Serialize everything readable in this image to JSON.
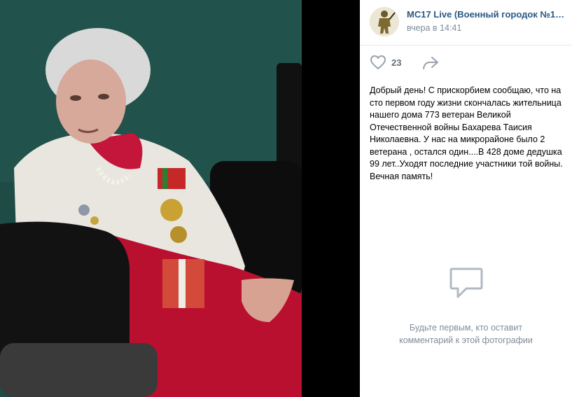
{
  "post": {
    "author": "MC17 Live (Военный городок №17(...",
    "date": "вчера в 14:41",
    "likes": "23",
    "text": "Добрый день! С прискорбием сообщаю, что на сто первом году жизни скончалась жительница нашего дома 773 ветеран Великой Отечественной войны Бахарева Таисия Николаевна. У нас на микрорайоне было 2 ветерана , остался один....В 428 доме дедушка 99 лет..Уходят последние участники той войны. Вечная память!"
  },
  "comments": {
    "empty_text": "Будьте первым, кто оставит комментарий к этой фотографии"
  },
  "icons": {
    "like": "heart-icon",
    "share": "share-arrow-icon",
    "comments": "comment-bubble-icon"
  },
  "colors": {
    "link": "#2a5885",
    "muted": "#818c99",
    "icon": "#99a2ad"
  }
}
